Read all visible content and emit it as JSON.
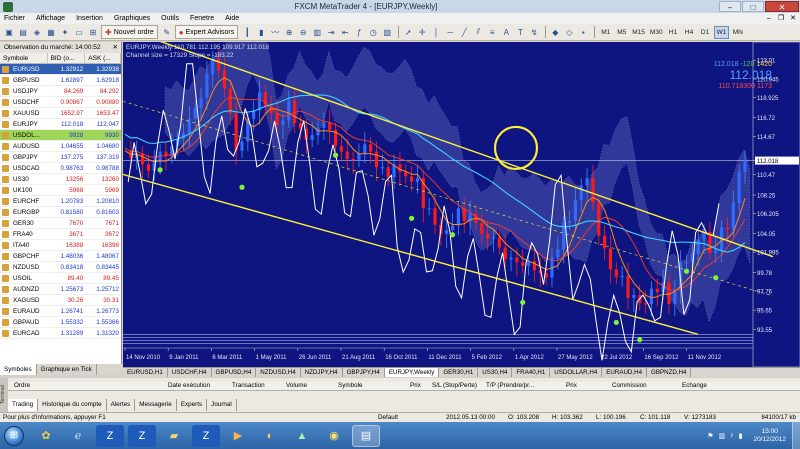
{
  "window": {
    "title": "FXCM MetaTrader 4 - [EURJPY,Weekly]",
    "minimize": "–",
    "maximize": "□",
    "close": "✕"
  },
  "menu": [
    "Fichier",
    "Affichage",
    "Insertion",
    "Graphiques",
    "Outils",
    "Fenetre",
    "Aide"
  ],
  "mdi_controls": [
    "–",
    "❐",
    "✕"
  ],
  "toolbar": {
    "new_order": "Nouvel ordre",
    "expert_advisors": "Expert Advisors",
    "timeframes": [
      "M1",
      "M5",
      "M15",
      "M30",
      "H1",
      "H4",
      "D1",
      "W1",
      "MN"
    ],
    "active_timeframe": "W1"
  },
  "market_watch": {
    "title": "Observation du marché: 14:00:52",
    "close": "✕",
    "columns": [
      "Symbole",
      "BID (o...",
      "ASK (..."
    ],
    "rows": [
      {
        "symbol": "EURUSD",
        "bid": "1.32912",
        "ask": "1.32938",
        "dir": "up",
        "state": "sel"
      },
      {
        "symbol": "GBPUSD",
        "bid": "1.62897",
        "ask": "1.62918",
        "dir": "up",
        "state": ""
      },
      {
        "symbol": "USDJPY",
        "bid": "84.269",
        "ask": "84.292",
        "dir": "down",
        "state": ""
      },
      {
        "symbol": "USDCHF",
        "bid": "0.90867",
        "ask": "0.90880",
        "dir": "down",
        "state": ""
      },
      {
        "symbol": "XAUUSD",
        "bid": "1652.97",
        "ask": "1653.47",
        "dir": "down",
        "state": ""
      },
      {
        "symbol": "EURJPY",
        "bid": "112.018",
        "ask": "112.047",
        "dir": "up",
        "state": ""
      },
      {
        "symbol": "USDOL...",
        "bid": "9928",
        "ask": "9930",
        "dir": "up",
        "state": "hl"
      },
      {
        "symbol": "AUDUSD",
        "bid": "1.04655",
        "ask": "1.04680",
        "dir": "up",
        "state": ""
      },
      {
        "symbol": "GBPJPY",
        "bid": "137.275",
        "ask": "137.319",
        "dir": "up",
        "state": ""
      },
      {
        "symbol": "USDCAD",
        "bid": "0.98763",
        "ask": "0.98788",
        "dir": "up",
        "state": ""
      },
      {
        "symbol": "US30",
        "bid": "13256",
        "ask": "13260",
        "dir": "down",
        "state": ""
      },
      {
        "symbol": "UK100",
        "bid": "5968",
        "ask": "5969",
        "dir": "down",
        "state": ""
      },
      {
        "symbol": "EURCHF",
        "bid": "1.20783",
        "ask": "1.20810",
        "dir": "up",
        "state": ""
      },
      {
        "symbol": "EURGBP",
        "bid": "0.81580",
        "ask": "0.81603",
        "dir": "up",
        "state": ""
      },
      {
        "symbol": "GER30",
        "bid": "7670",
        "ask": "7671",
        "dir": "down",
        "state": ""
      },
      {
        "symbol": "FRA40",
        "bid": "3671",
        "ask": "3672",
        "dir": "down",
        "state": ""
      },
      {
        "symbol": "ITA40",
        "bid": "16388",
        "ask": "16398",
        "dir": "down",
        "state": ""
      },
      {
        "symbol": "GBPCHF",
        "bid": "1.48036",
        "ask": "1.48067",
        "dir": "up",
        "state": ""
      },
      {
        "symbol": "NZDUSD",
        "bid": "0.83418",
        "ask": "0.83445",
        "dir": "up",
        "state": ""
      },
      {
        "symbol": "USOIL",
        "bid": "89.40",
        "ask": "89.45",
        "dir": "down",
        "state": ""
      },
      {
        "symbol": "AUDNZD",
        "bid": "1.25673",
        "ask": "1.25712",
        "dir": "up",
        "state": ""
      },
      {
        "symbol": "XAGUSD",
        "bid": "30.26",
        "ask": "30.31",
        "dir": "down",
        "state": ""
      },
      {
        "symbol": "EURAUD",
        "bid": "1.26741",
        "ask": "1.26773",
        "dir": "up",
        "state": ""
      },
      {
        "symbol": "GBPAUD",
        "bid": "1.55332",
        "ask": "1.55366",
        "dir": "up",
        "state": ""
      },
      {
        "symbol": "EURCAD",
        "bid": "1.31289",
        "ask": "1.31320",
        "dir": "up",
        "state": ""
      }
    ],
    "tabs": [
      "Symboles",
      "Graphique en Tick"
    ]
  },
  "chart": {
    "header_line1": "EURJPY,Weekly  110.781 112.195 109.917 112.018",
    "header_line2": "Channel size = 17329 Slope = -183.22",
    "topright": {
      "line1_a": "112.018",
      "line1_b": "-120",
      "line1_c": "1420",
      "big": "112.018",
      "line3_a": "110.718300",
      "line3_b": "1173"
    }
  },
  "chart_data": {
    "type": "candlestick",
    "symbol": "EURJPY",
    "timeframe": "Weekly",
    "ohlc_last": {
      "open": 110.781,
      "high": 112.195,
      "low": 109.917,
      "close": 112.018
    },
    "y_ticks": [
      123.01,
      120.945,
      118.925,
      116.72,
      114.67,
      112.018,
      110.47,
      108.25,
      106.205,
      104.05,
      101.995,
      99.78,
      97.76,
      95.65,
      93.55
    ],
    "x_ticks": [
      "14 Nov 2010",
      "9 Jan 2011",
      "6 Mar 2011",
      "1 May 2011",
      "26 Jun 2011",
      "21 Aug 2011",
      "16 Oct 2011",
      "11 Dec 2011",
      "5 Feb 2012",
      "1 Apr 2012",
      "27 May 2012",
      "22 Jul 2012",
      "16 Sep 2012",
      "11 Nov 2012"
    ],
    "ylim": [
      91.5,
      125
    ],
    "price_line": 112.018,
    "price_path": [
      [
        0,
        113.1
      ],
      [
        1,
        112.3
      ],
      [
        2,
        112.8
      ],
      [
        3,
        111.6
      ],
      [
        4,
        110.9
      ],
      [
        5,
        111.8
      ],
      [
        6,
        113.0
      ],
      [
        7,
        112.5
      ],
      [
        8,
        113.6
      ],
      [
        9,
        114.4
      ],
      [
        10,
        115.0
      ],
      [
        11,
        116.6
      ],
      [
        12,
        117.8
      ],
      [
        13,
        118.9
      ],
      [
        14,
        121.5
      ],
      [
        15,
        123.2
      ],
      [
        16,
        121.9
      ],
      [
        17,
        119.9
      ],
      [
        18,
        117.2
      ],
      [
        19,
        113.1
      ],
      [
        20,
        114.1
      ],
      [
        21,
        116.6
      ],
      [
        22,
        117.5
      ],
      [
        23,
        119.5
      ],
      [
        24,
        118.0
      ],
      [
        25,
        117.2
      ],
      [
        26,
        115.9
      ],
      [
        27,
        116.4
      ],
      [
        28,
        118.6
      ],
      [
        29,
        116.1
      ],
      [
        30,
        115.5
      ],
      [
        31,
        114.3
      ],
      [
        32,
        114.8
      ],
      [
        33,
        115.6
      ],
      [
        34,
        116.2
      ],
      [
        35,
        115.4
      ],
      [
        36,
        113.6
      ],
      [
        37,
        113.0
      ],
      [
        38,
        112.2
      ],
      [
        39,
        112.1
      ],
      [
        40,
        112.8
      ],
      [
        41,
        113.8
      ],
      [
        42,
        113.0
      ],
      [
        43,
        111.3
      ],
      [
        44,
        111.3
      ],
      [
        45,
        110.2
      ],
      [
        46,
        111.6
      ],
      [
        47,
        110.8
      ],
      [
        48,
        110.3
      ],
      [
        49,
        109.7
      ],
      [
        50,
        110.1
      ],
      [
        51,
        106.8
      ],
      [
        52,
        106.8
      ],
      [
        53,
        105.0
      ],
      [
        54,
        104.0
      ],
      [
        55,
        104.4
      ],
      [
        56,
        104.9
      ],
      [
        57,
        106.8
      ],
      [
        58,
        105.4
      ],
      [
        59,
        106.2
      ],
      [
        60,
        105.2
      ],
      [
        61,
        104.0
      ],
      [
        62,
        103.5
      ],
      [
        63,
        103.6
      ],
      [
        64,
        102.5
      ],
      [
        65,
        101.2
      ],
      [
        66,
        101.4
      ],
      [
        67,
        100.9
      ],
      [
        68,
        100.5
      ],
      [
        69,
        101.0
      ],
      [
        70,
        100.0
      ],
      [
        71,
        99.7
      ],
      [
        72,
        99.2
      ],
      [
        73,
        101.4
      ],
      [
        74,
        102.3
      ],
      [
        75,
        105.2
      ],
      [
        76,
        105.4
      ],
      [
        77,
        107.7
      ],
      [
        78,
        109.3
      ],
      [
        79,
        110.1
      ],
      [
        80,
        107.4
      ],
      [
        81,
        103.8
      ],
      [
        82,
        102.4
      ],
      [
        83,
        100.1
      ],
      [
        84,
        99.3
      ],
      [
        85,
        99.4
      ],
      [
        86,
        97.0
      ],
      [
        87,
        97.3
      ],
      [
        88,
        96.4
      ],
      [
        89,
        96.3
      ],
      [
        90,
        98.0
      ],
      [
        91,
        97.6
      ],
      [
        92,
        98.7
      ],
      [
        93,
        96.3
      ],
      [
        94,
        97.9
      ],
      [
        95,
        100.8
      ],
      [
        96,
        100.9
      ],
      [
        97,
        101.8
      ],
      [
        98,
        103.4
      ],
      [
        99,
        104.2
      ],
      [
        100,
        101.9
      ],
      [
        101,
        102.2
      ],
      [
        102,
        104.7
      ],
      [
        103,
        104.5
      ],
      [
        104,
        107.4
      ],
      [
        105,
        110.8
      ],
      [
        106,
        112.0
      ]
    ],
    "channel": {
      "upper_start": 126.5,
      "upper_end": 101.5,
      "lower_start": 110.5,
      "lower_end": 93.0,
      "mid_start": 118.5,
      "mid_end": 97.2
    }
  },
  "chart_tabs": [
    "EURUSD,H1",
    "USDCHF,H4",
    "GBPUSD,H4",
    "NZDUSD,H4",
    "NZDJPY,H4",
    "GBPJPY,H4",
    "EURJPY,Weekly",
    "GER30,H1",
    "US30,H4",
    "FRA40,H1",
    "USDOLLAR,H4",
    "EURAUD,H4",
    "GBPNZD,H4"
  ],
  "chart_tabs_active": "EURJPY,Weekly",
  "terminal": {
    "side_label": "Terminal",
    "columns": [
      "Ordre",
      "Date exécution",
      "Transaction",
      "Volume",
      "Symbole",
      "Prix",
      "S/L (Stop/Perte)",
      "T/P (Prendre/pr...",
      "Prix",
      "Commission",
      "Echange"
    ],
    "tabs": [
      "Trading",
      "Historique du compte",
      "Alertes",
      "Messagerie",
      "Experts",
      "Journal"
    ],
    "active_tab": "Trading"
  },
  "status": {
    "help": "Pour plus d'informations, appuyer F1",
    "profile": "Default",
    "datetime": "2012.05.13 00:00",
    "open": "O: 103.208",
    "high": "H: 103.362",
    "low": "L: 100.196",
    "close": "C: 101.118",
    "volume": "V: 1273183",
    "traffic": "84100/17 kb"
  },
  "taskbar": {
    "time": "15:00",
    "date": "20/12/2012"
  }
}
